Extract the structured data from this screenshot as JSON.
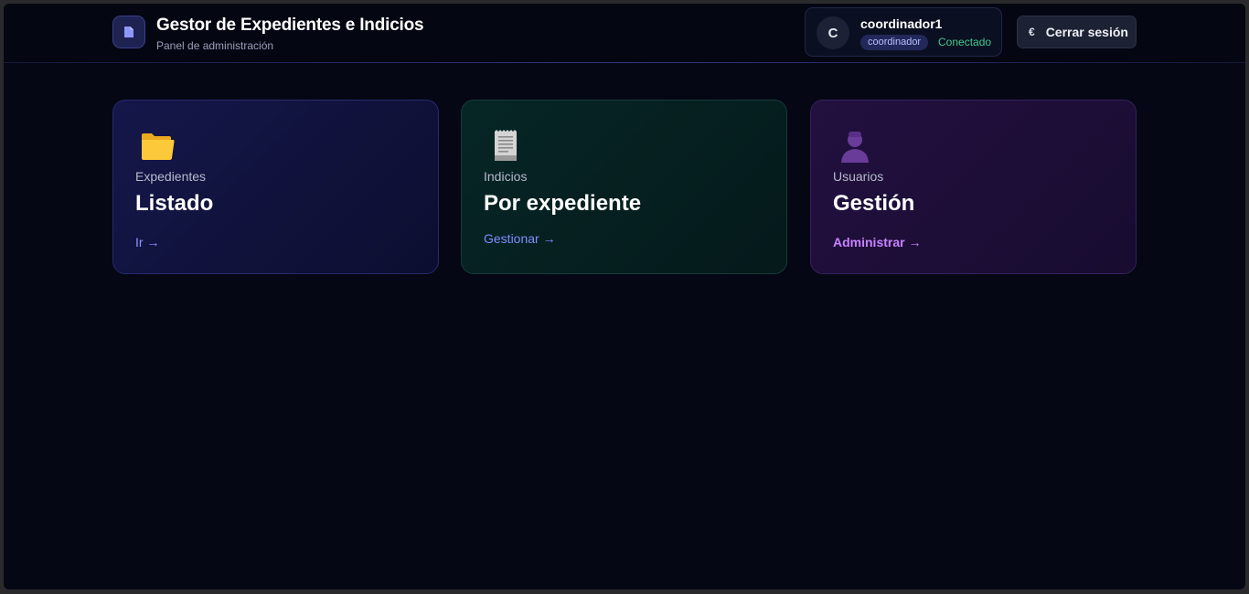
{
  "header": {
    "title": "Gestor de Expedientes e Indicios",
    "subtitle": "Panel de administración",
    "logo_icon": "document-icon"
  },
  "user": {
    "avatar_initial": "C",
    "username": "coordinador1",
    "role": "coordinador",
    "status": "Conectado",
    "status_color": "#43c98a"
  },
  "logout": {
    "label": "Cerrar sesión",
    "icon": "logout-icon",
    "icon_glyph": "€"
  },
  "cards": [
    {
      "category": "Expedientes",
      "title": "Listado",
      "link": "Ir →",
      "icon": "folder-icon",
      "accent": "#8e93ff"
    },
    {
      "category": "Indicios",
      "title": "Por expediente",
      "link": "Gestionar →",
      "icon": "receipt-icon",
      "accent": "#7f8dff"
    },
    {
      "category": "Usuarios",
      "title": "Gestión",
      "link": "Administrar →",
      "icon": "user-icon",
      "accent": "#c982ff"
    }
  ]
}
